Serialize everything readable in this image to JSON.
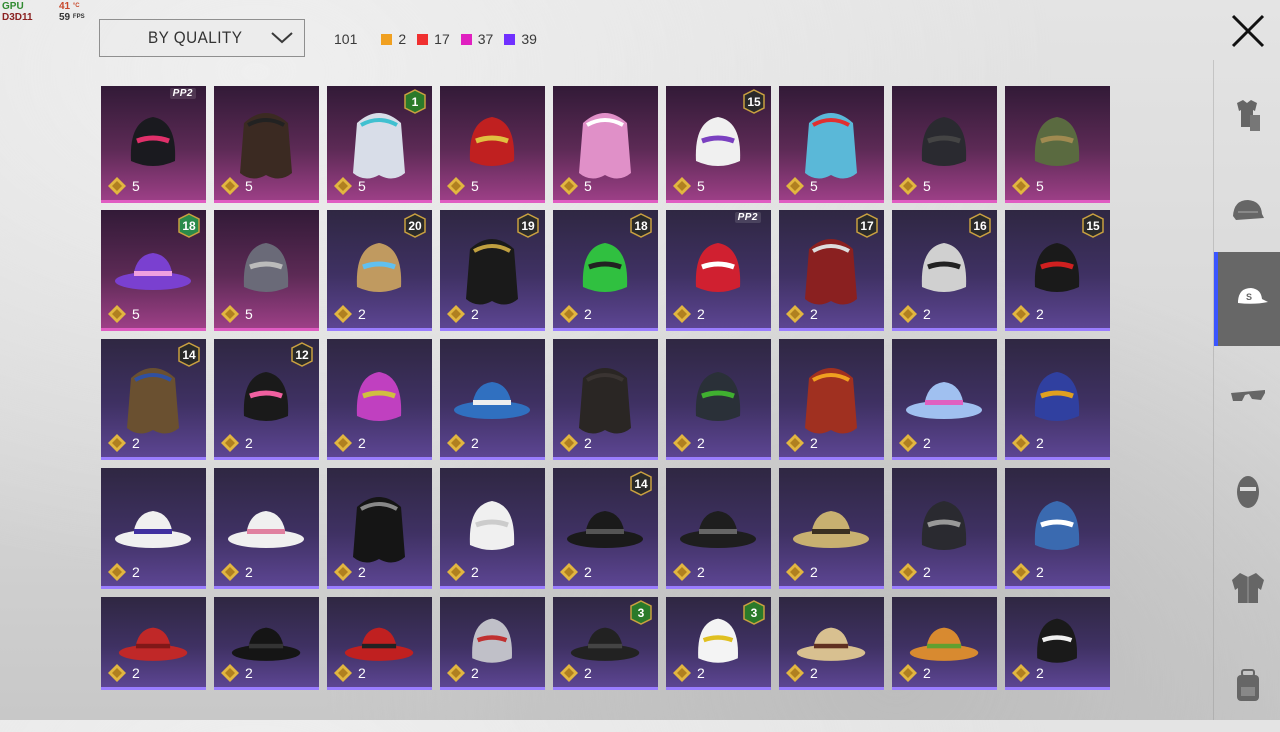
{
  "perf_overlay": {
    "gpu_label": "GPU",
    "api_label": "D3D11",
    "temp_value": "41",
    "temp_unit": "°C",
    "fps_value": "59",
    "fps_unit": "FPS"
  },
  "sort": {
    "selected": "BY QUALITY"
  },
  "counts": {
    "total": "101",
    "groups": [
      {
        "color": "#f0a020",
        "value": "2"
      },
      {
        "color": "#f03030",
        "value": "17"
      },
      {
        "color": "#e020c0",
        "value": "37"
      },
      {
        "color": "#7030ff",
        "value": "39"
      }
    ]
  },
  "sidebar": {
    "tabs": [
      {
        "icon": "outfit-icon",
        "active": false
      },
      {
        "icon": "helmet-icon",
        "active": false
      },
      {
        "icon": "cap-icon",
        "active": true
      },
      {
        "icon": "glasses-icon",
        "active": false
      },
      {
        "icon": "mask-icon",
        "active": false
      },
      {
        "icon": "jacket-icon",
        "active": false
      },
      {
        "icon": "backpack-icon",
        "active": false
      }
    ]
  },
  "colors": {
    "pink_quality": "#e05cc2",
    "purple_quality": "#9a7dff",
    "active_tab": "#3a55ff",
    "price_icon": "#e2b640"
  },
  "items": [
    {
      "quality": "pink",
      "badge": "PP2",
      "art": "demon-helmet",
      "price": "5"
    },
    {
      "quality": "pink",
      "badge": "",
      "art": "cat-ear-hair",
      "price": "5"
    },
    {
      "quality": "pink",
      "badge": "1",
      "art": "twin-tail-hair",
      "price": "5"
    },
    {
      "quality": "pink",
      "badge": "",
      "art": "red-warrior-mask",
      "price": "5"
    },
    {
      "quality": "pink",
      "badge": "",
      "art": "pink-long-hair",
      "price": "5"
    },
    {
      "quality": "pink",
      "badge": "15",
      "art": "bird-head",
      "price": "5"
    },
    {
      "quality": "pink",
      "badge": "",
      "art": "blue-pigtails",
      "price": "5"
    },
    {
      "quality": "pink",
      "badge": "",
      "art": "black-mask",
      "price": "5"
    },
    {
      "quality": "pink",
      "badge": "",
      "art": "green-goblin-mask",
      "price": "5"
    },
    {
      "quality": "pink",
      "badge": "18",
      "art": "purple-spiked-hat",
      "price": "5"
    },
    {
      "quality": "pink",
      "badge": "",
      "art": "spiked-helmet",
      "price": "5"
    },
    {
      "quality": "purple",
      "badge": "20",
      "art": "blonde-headband",
      "price": "2"
    },
    {
      "quality": "purple",
      "badge": "19",
      "art": "black-hair-pin",
      "price": "2"
    },
    {
      "quality": "purple",
      "badge": "18",
      "art": "green-beanie",
      "price": "2"
    },
    {
      "quality": "purple",
      "badge": "PP2",
      "art": "heart-headband",
      "price": "2"
    },
    {
      "quality": "purple",
      "badge": "17",
      "art": "crown-red-hair",
      "price": "2"
    },
    {
      "quality": "purple",
      "badge": "16",
      "art": "goggle-beanie",
      "price": "2"
    },
    {
      "quality": "purple",
      "badge": "15",
      "art": "pumpkin-hood",
      "price": "2"
    },
    {
      "quality": "purple",
      "badge": "14",
      "art": "cat-cap-hair",
      "price": "2"
    },
    {
      "quality": "purple",
      "badge": "12",
      "art": "bunny-helmet",
      "price": "2"
    },
    {
      "quality": "purple",
      "badge": "",
      "art": "horn-headband",
      "price": "2"
    },
    {
      "quality": "purple",
      "badge": "",
      "art": "blue-cap",
      "price": "2"
    },
    {
      "quality": "purple",
      "badge": "",
      "art": "dark-long-hair",
      "price": "2"
    },
    {
      "quality": "purple",
      "badge": "",
      "art": "gas-mask-helmet",
      "price": "2"
    },
    {
      "quality": "purple",
      "badge": "",
      "art": "orange-goggles-hair",
      "price": "2"
    },
    {
      "quality": "purple",
      "badge": "",
      "art": "rainbow-cap",
      "price": "2"
    },
    {
      "quality": "purple",
      "badge": "",
      "art": "gold-headphones",
      "price": "2"
    },
    {
      "quality": "purple",
      "badge": "",
      "art": "white-sun-hat",
      "price": "2"
    },
    {
      "quality": "purple",
      "badge": "",
      "art": "flower-sun-hat",
      "price": "2"
    },
    {
      "quality": "purple",
      "badge": "",
      "art": "black-ponytail",
      "price": "2"
    },
    {
      "quality": "purple",
      "badge": "",
      "art": "white-turban",
      "price": "2"
    },
    {
      "quality": "purple",
      "badge": "14",
      "art": "police-cap",
      "price": "2"
    },
    {
      "quality": "purple",
      "badge": "",
      "art": "black-top-hat",
      "price": "2"
    },
    {
      "quality": "purple",
      "badge": "",
      "art": "straw-hat",
      "price": "2"
    },
    {
      "quality": "purple",
      "badge": "",
      "art": "black-wrestler-mask",
      "price": "2"
    },
    {
      "quality": "purple",
      "badge": "",
      "art": "shark-hood",
      "price": "2"
    },
    {
      "quality": "purple",
      "badge": "",
      "art": "red-beret",
      "price": "2"
    },
    {
      "quality": "purple",
      "badge": "",
      "art": "black-fedora",
      "price": "2"
    },
    {
      "quality": "purple",
      "badge": "",
      "art": "red-fedora",
      "price": "2"
    },
    {
      "quality": "purple",
      "badge": "",
      "art": "shark-mask",
      "price": "2"
    },
    {
      "quality": "purple",
      "badge": "3",
      "art": "dark-fedora",
      "price": "2"
    },
    {
      "quality": "purple",
      "badge": "3",
      "art": "flower-crown",
      "price": "2"
    },
    {
      "quality": "purple",
      "badge": "",
      "art": "cake-hat",
      "price": "2"
    },
    {
      "quality": "purple",
      "badge": "",
      "art": "burger-hat",
      "price": "2"
    },
    {
      "quality": "purple",
      "badge": "",
      "art": "doctor-head-mirror",
      "price": "2"
    }
  ]
}
